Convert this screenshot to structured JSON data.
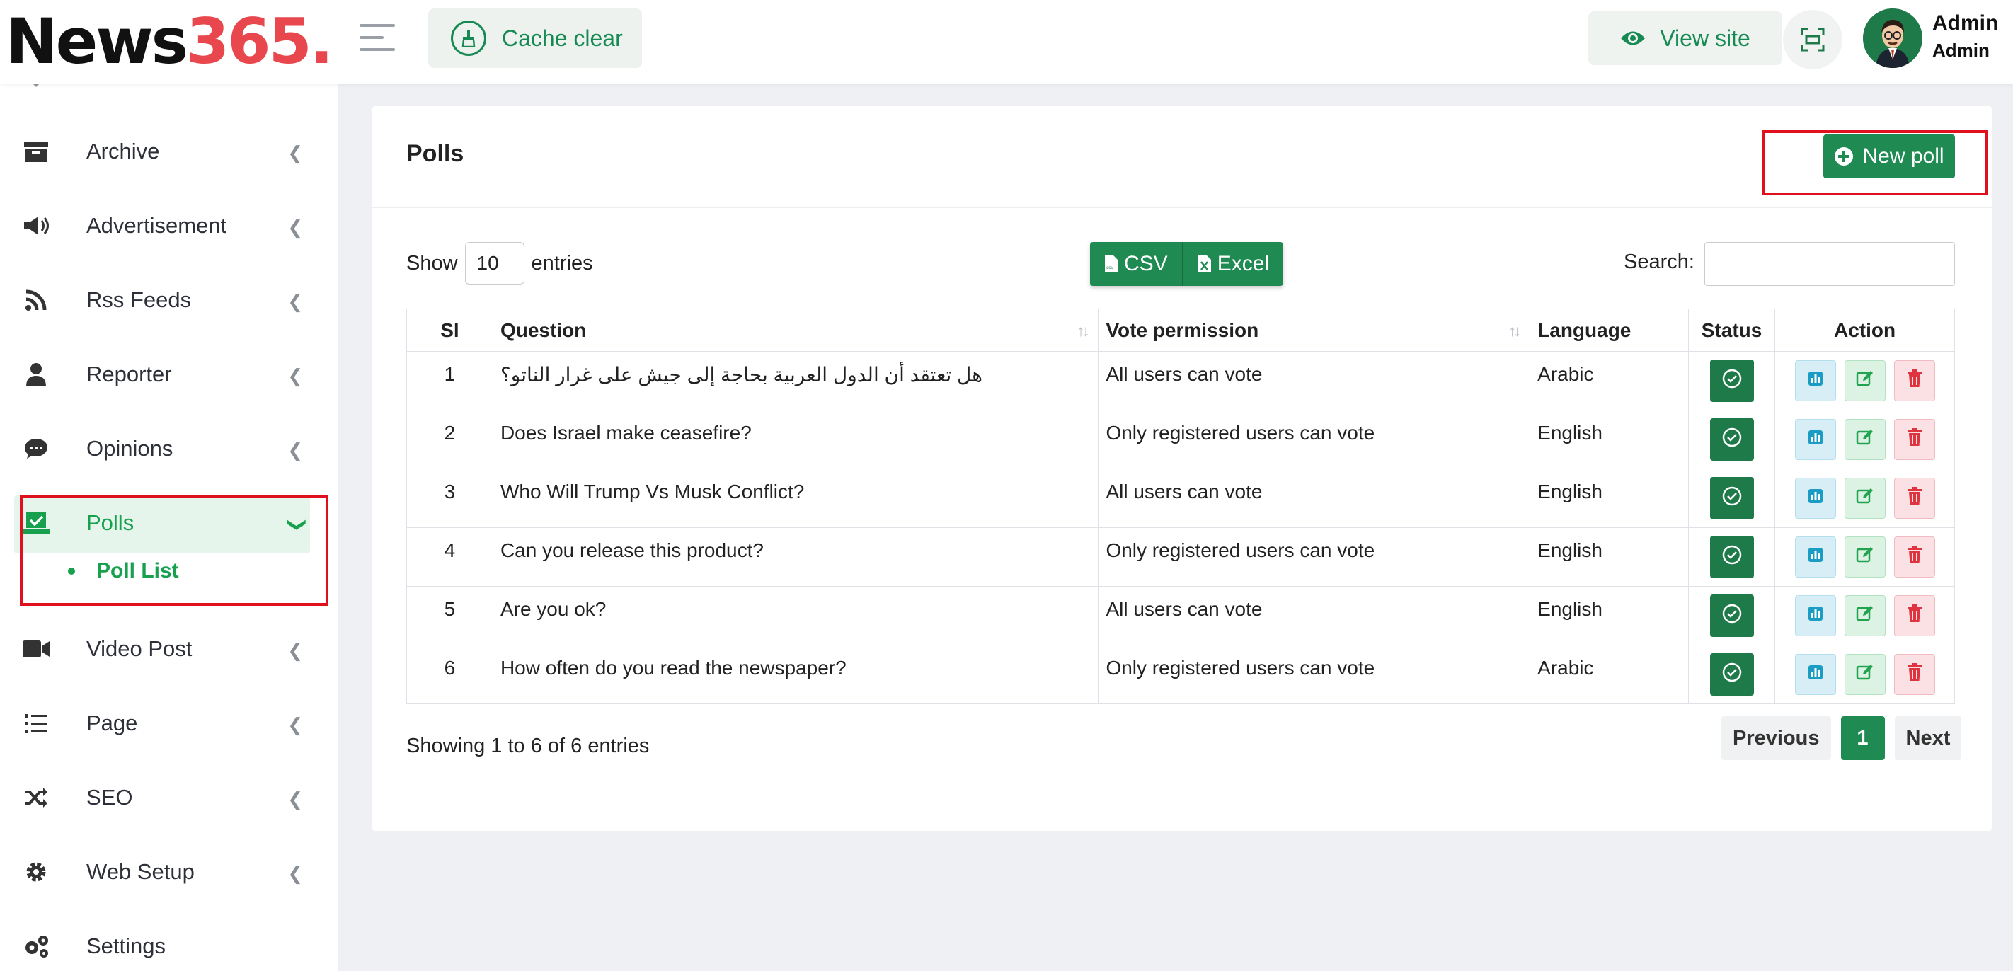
{
  "brand": {
    "part1": "News",
    "part2": "365."
  },
  "header": {
    "cache_label": "Cache clear",
    "view_site_label": "View site",
    "user_name": "Admin",
    "user_role": "Admin"
  },
  "sidebar": {
    "items": [
      {
        "label": "Archive",
        "icon": "archive-icon"
      },
      {
        "label": "Advertisement",
        "icon": "megaphone-icon"
      },
      {
        "label": "Rss Feeds",
        "icon": "rss-icon"
      },
      {
        "label": "Reporter",
        "icon": "person-icon"
      },
      {
        "label": "Opinions",
        "icon": "comment-icon"
      },
      {
        "label": "Polls",
        "icon": "poll-icon"
      },
      {
        "label": "Video Post",
        "icon": "video-icon"
      },
      {
        "label": "Page",
        "icon": "list-icon"
      },
      {
        "label": "SEO",
        "icon": "shuffle-icon"
      },
      {
        "label": "Web Setup",
        "icon": "gear-icon"
      },
      {
        "label": "Settings",
        "icon": "gears-icon"
      }
    ],
    "sub_item": "Poll List"
  },
  "main": {
    "title": "Polls",
    "new_button": "New poll",
    "show_label": "Show",
    "entries_value": "10",
    "entries_label": "entries",
    "csv_label": "CSV",
    "excel_label": "Excel",
    "search_label": "Search:",
    "columns": [
      "Sl",
      "Question",
      "Vote permission",
      "Language",
      "Status",
      "Action"
    ],
    "rows": [
      {
        "sl": "1",
        "question": "هل تعتقد أن الدول العربية بحاجة إلى جيش على غرار الناتو؟",
        "permission": "All users can vote",
        "language": "Arabic"
      },
      {
        "sl": "2",
        "question": "Does Israel make ceasefire?",
        "permission": "Only registered users can vote",
        "language": "English"
      },
      {
        "sl": "3",
        "question": "Who Will Trump Vs Musk Conflict?",
        "permission": "All users can vote",
        "language": "English"
      },
      {
        "sl": "4",
        "question": "Can you release this product?",
        "permission": "Only registered users can vote",
        "language": "English"
      },
      {
        "sl": "5",
        "question": "Are you ok?",
        "permission": "All users can vote",
        "language": "English"
      },
      {
        "sl": "6",
        "question": "How often do you read the newspaper?",
        "permission": "Only registered users can vote",
        "language": "Arabic"
      }
    ],
    "info": "Showing 1 to 6 of 6 entries",
    "pagination": {
      "prev": "Previous",
      "current": "1",
      "next": "Next"
    }
  },
  "colors": {
    "accent": "#1f8a52",
    "brand_red": "#e8474d",
    "highlight": "#e0101e"
  }
}
